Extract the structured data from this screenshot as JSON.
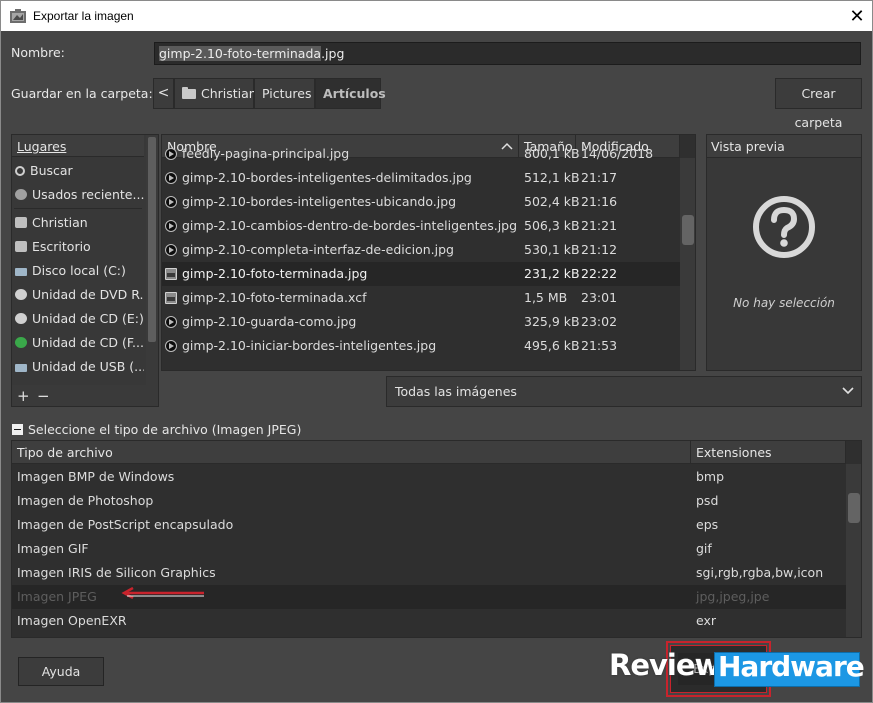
{
  "window": {
    "title": "Exportar la imagen",
    "close_glyph": "✕"
  },
  "name_field": {
    "label": "Nombre:",
    "value_stem": "gimp-2.10-foto-terminada",
    "value_ext": ".jpg"
  },
  "folder": {
    "label": "Guardar en la carpeta:",
    "back_glyph": "<",
    "crumbs": [
      "Christian",
      "Pictures",
      "Artículos"
    ],
    "create_button": "Crear carpeta"
  },
  "places": {
    "header": "Lugares",
    "items": [
      "Buscar",
      "Usados reciente...",
      "Christian",
      "Escritorio",
      "Disco local (C:)",
      "Unidad de DVD R...",
      "Unidad de CD (E:)",
      "Unidad de CD (F...",
      "Unidad de USB (..."
    ],
    "add_glyph": "+",
    "remove_glyph": "−"
  },
  "files": {
    "columns": {
      "name": "Nombre",
      "size": "Tamaño",
      "modified": "Modificado"
    },
    "rows": [
      {
        "name": "feedly-pagina-principal.jpg",
        "size": "800,1 kB",
        "modified": "14/06/2018",
        "icon": "image-file-icon"
      },
      {
        "name": "gimp-2.10-bordes-inteligentes-delimitados.jpg",
        "size": "512,1 kB",
        "modified": "21:17",
        "icon": "image-file-icon"
      },
      {
        "name": "gimp-2.10-bordes-inteligentes-ubicando.jpg",
        "size": "502,4 kB",
        "modified": "21:16",
        "icon": "image-file-icon"
      },
      {
        "name": "gimp-2.10-cambios-dentro-de-bordes-inteligentes.jpg",
        "size": "506,3 kB",
        "modified": "21:21",
        "icon": "image-file-icon"
      },
      {
        "name": "gimp-2.10-completa-interfaz-de-edicion.jpg",
        "size": "530,1 kB",
        "modified": "21:12",
        "icon": "image-file-icon"
      },
      {
        "name": "gimp-2.10-foto-terminada.jpg",
        "size": "231,2 kB",
        "modified": "22:22",
        "icon": "gimp-image-icon",
        "selected": true
      },
      {
        "name": "gimp-2.10-foto-terminada.xcf",
        "size": "1,5 MB",
        "modified": "23:01",
        "icon": "gimp-image-icon"
      },
      {
        "name": "gimp-2.10-guarda-como.jpg",
        "size": "325,9 kB",
        "modified": "23:02",
        "icon": "image-file-icon"
      },
      {
        "name": "gimp-2.10-iniciar-bordes-inteligentes.jpg",
        "size": "495,6 kB",
        "modified": "21:53",
        "icon": "image-file-icon"
      }
    ]
  },
  "preview": {
    "header": "Vista previa",
    "empty_text": "No hay selección",
    "icon": "question-icon"
  },
  "filter": {
    "value": "Todas las imágenes"
  },
  "file_type": {
    "toggle_label": "Seleccione el tipo de archivo (Imagen JPEG)",
    "columns": {
      "type": "Tipo de archivo",
      "ext": "Extensiones"
    },
    "rows": [
      {
        "type": "Imagen BMP de Windows",
        "ext": "bmp"
      },
      {
        "type": "Imagen de Photoshop",
        "ext": "psd"
      },
      {
        "type": "Imagen de PostScript encapsulado",
        "ext": "eps"
      },
      {
        "type": "Imagen GIF",
        "ext": "gif"
      },
      {
        "type": "Imagen IRIS de Silicon Graphics",
        "ext": "sgi,rgb,rgba,bw,icon"
      },
      {
        "type": "Imagen JPEG",
        "ext": "jpg,jpeg,jpe",
        "selected": true
      },
      {
        "type": "Imagen OpenEXR",
        "ext": "exr"
      }
    ]
  },
  "buttons": {
    "help": "Ayuda",
    "export": "Exportar"
  },
  "watermark": {
    "review": "Review",
    "hardware": "Hardware"
  },
  "colors": {
    "accent_red": "#c8232c",
    "watermark_blue": "#1c97e4",
    "bg": "#454545"
  }
}
